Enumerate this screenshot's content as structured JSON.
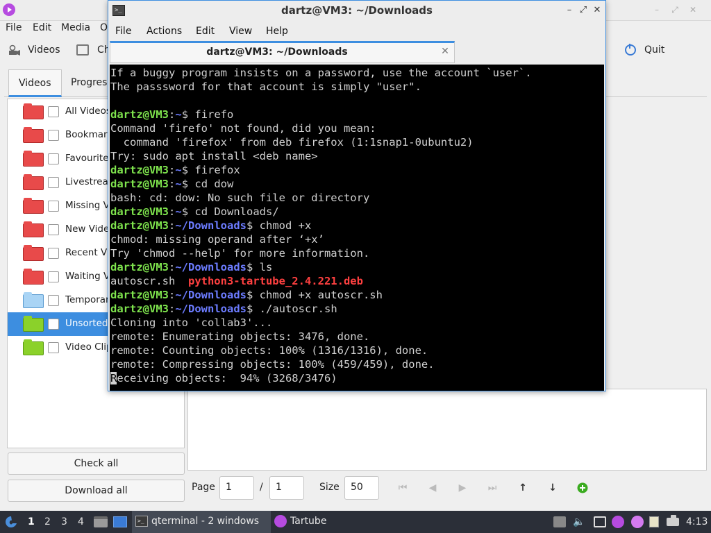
{
  "tartube": {
    "menu": [
      "File",
      "Edit",
      "Media",
      "O"
    ],
    "toolbar": {
      "videos": "Videos",
      "channels": "Ch",
      "quit": "Quit"
    },
    "tabs": [
      "Videos",
      "Progress"
    ],
    "folders": [
      {
        "label": "All Videos",
        "color": "red"
      },
      {
        "label": "Bookmar",
        "color": "red"
      },
      {
        "label": "Favourite",
        "color": "red"
      },
      {
        "label": "Livestrea",
        "color": "red"
      },
      {
        "label": "Missing V",
        "color": "red"
      },
      {
        "label": "New Vide",
        "color": "red"
      },
      {
        "label": "Recent Vi",
        "color": "red"
      },
      {
        "label": "Waiting V",
        "color": "red"
      },
      {
        "label": "Temporar",
        "color": "blue"
      },
      {
        "label": "Unsorted",
        "color": "green"
      },
      {
        "label": "Video Clip",
        "color": "green"
      }
    ],
    "check_all": "Check all",
    "download_all": "Download all",
    "pager": {
      "page_label": "Page",
      "page_value": "1",
      "separator": "/",
      "total_value": "1",
      "size_label": "Size",
      "size_value": "50"
    }
  },
  "terminal": {
    "window_title": "dartz@VM3: ~/Downloads",
    "menu": [
      "File",
      "Actions",
      "Edit",
      "View",
      "Help"
    ],
    "tab_title": "dartz@VM3: ~/Downloads",
    "prompt_user": "dartz@VM3",
    "lines": [
      {
        "type": "out",
        "text": "If a buggy program insists on a password, use the account `user`."
      },
      {
        "type": "out",
        "text": "The passsword for that account is simply \"user\"."
      },
      {
        "type": "out",
        "text": ""
      },
      {
        "type": "cmd",
        "path": "~",
        "cmd": "firefo"
      },
      {
        "type": "out",
        "text": "Command 'firefo' not found, did you mean:"
      },
      {
        "type": "out",
        "text": "  command 'firefox' from deb firefox (1:1snap1-0ubuntu2)"
      },
      {
        "type": "out",
        "text": "Try: sudo apt install <deb name>"
      },
      {
        "type": "cmd",
        "path": "~",
        "cmd": "firefox"
      },
      {
        "type": "cmd",
        "path": "~",
        "cmd": "cd dow"
      },
      {
        "type": "out",
        "text": "bash: cd: dow: No such file or directory"
      },
      {
        "type": "cmd",
        "path": "~",
        "cmd": "cd Downloads/"
      },
      {
        "type": "cmd",
        "path": "~/Downloads",
        "cmd": "chmod +x"
      },
      {
        "type": "out",
        "text": "chmod: missing operand after ‘+x’"
      },
      {
        "type": "out",
        "text": "Try 'chmod --help' for more information."
      },
      {
        "type": "cmd",
        "path": "~/Downloads",
        "cmd": "ls"
      },
      {
        "type": "ls",
        "plain": "autoscr.sh  ",
        "red": "python3-tartube_2.4.221.deb"
      },
      {
        "type": "cmd",
        "path": "~/Downloads",
        "cmd": "chmod +x autoscr.sh"
      },
      {
        "type": "cmd",
        "path": "~/Downloads",
        "cmd": "./autoscr.sh"
      },
      {
        "type": "out",
        "text": "Cloning into 'collab3'..."
      },
      {
        "type": "out",
        "text": "remote: Enumerating objects: 3476, done."
      },
      {
        "type": "out",
        "text": "remote: Counting objects: 100% (1316/1316), done."
      },
      {
        "type": "out",
        "text": "remote: Compressing objects: 100% (459/459), done."
      },
      {
        "type": "cursor",
        "cursor_char": "R",
        "text": "eceiving objects:  94% (3268/3476)"
      }
    ]
  },
  "taskbar": {
    "workspaces": [
      "1",
      "2",
      "3",
      "4"
    ],
    "tasks": [
      {
        "label": "qterminal - 2 windows",
        "icon": "terminal-icon"
      },
      {
        "label": "Tartube",
        "icon": "tartube-icon"
      }
    ],
    "tray_icons": [
      "storage-icon",
      "volume-icon",
      "screen-switch-icon",
      "tartube-tray-icon",
      "tartube-tray-icon-2",
      "clipboard-icon",
      "keyboard-icon",
      "network-icon"
    ],
    "clock": "4:13"
  }
}
